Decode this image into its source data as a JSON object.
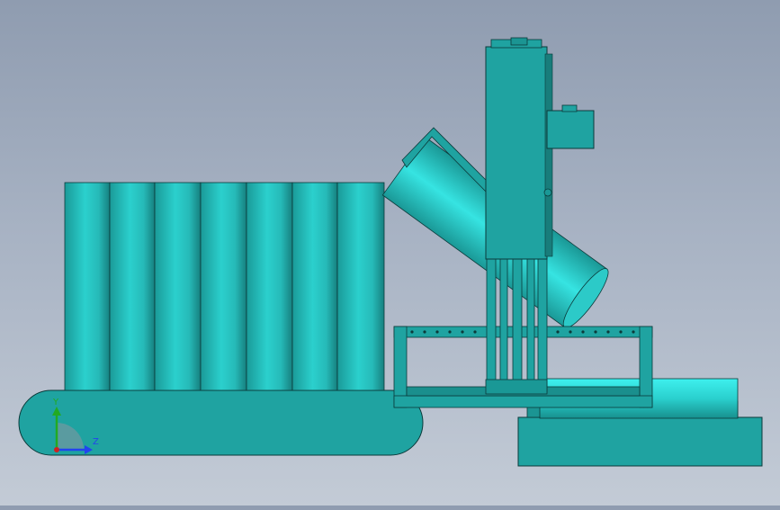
{
  "viewport": {
    "background_top": "#8f9cb0",
    "background_bottom": "#c3cbd6",
    "model_color": "#1fa3a1",
    "highlight_color": "#38e6e6",
    "edge_color": "#0b3a3a"
  },
  "triad": {
    "x_label": "",
    "y_label": "Y",
    "z_label": "Z",
    "x_color": "#cc2222",
    "y_color": "#22aa22",
    "z_color": "#2244ee"
  },
  "model": {
    "cylinder_count": 7,
    "parts": [
      "conveyor-belt",
      "cylinder-row",
      "tower",
      "tilted-cylinder",
      "frame",
      "motor-box",
      "base-block",
      "horizontal-cylinder"
    ]
  }
}
